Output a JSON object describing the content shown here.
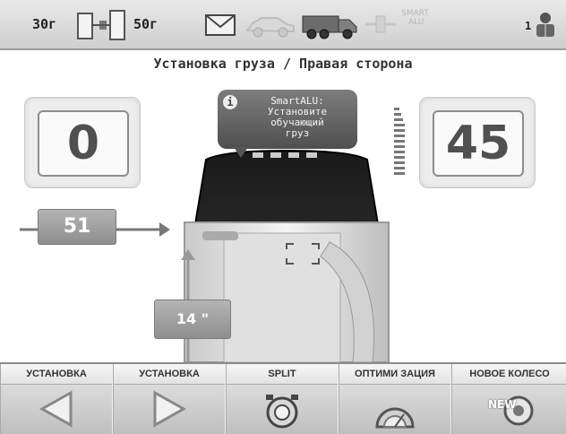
{
  "top_bar": {
    "min_weight": "30г",
    "max_weight": "50г",
    "smart_label_line1": "SMART",
    "smart_label_line2": "ALU",
    "user_indicator": "1"
  },
  "screen": {
    "title": "Установка груза / Правая сторона"
  },
  "left_display": {
    "value": "0"
  },
  "right_display": {
    "value": "45"
  },
  "info_bubble": {
    "icon_text": "i",
    "line1": "SmartALU:",
    "line2": "Установите",
    "line3": "обучающий",
    "line4": "груз"
  },
  "distance_tag": {
    "value": "51"
  },
  "diameter_tag": {
    "value": "14 \""
  },
  "bottom_buttons": [
    {
      "label": "УСТАНОВКА",
      "icon": "arrow-left-icon"
    },
    {
      "label": "УСТАНОВКА",
      "icon": "arrow-right-icon"
    },
    {
      "label": "SPLIT",
      "icon": "split-icon"
    },
    {
      "label": "ОПТИМИ ЗАЦИЯ",
      "icon": "optimization-icon"
    },
    {
      "label": "НОВОЕ КОЛЕСО",
      "icon": "new-wheel-icon"
    }
  ],
  "new_wheel_badge": "NEW",
  "colors": {
    "panel_bg": "#ededed",
    "bubble_bg": "#5f5f5f",
    "tag_bg": "#9c9c9c",
    "text_dark": "#333333"
  }
}
